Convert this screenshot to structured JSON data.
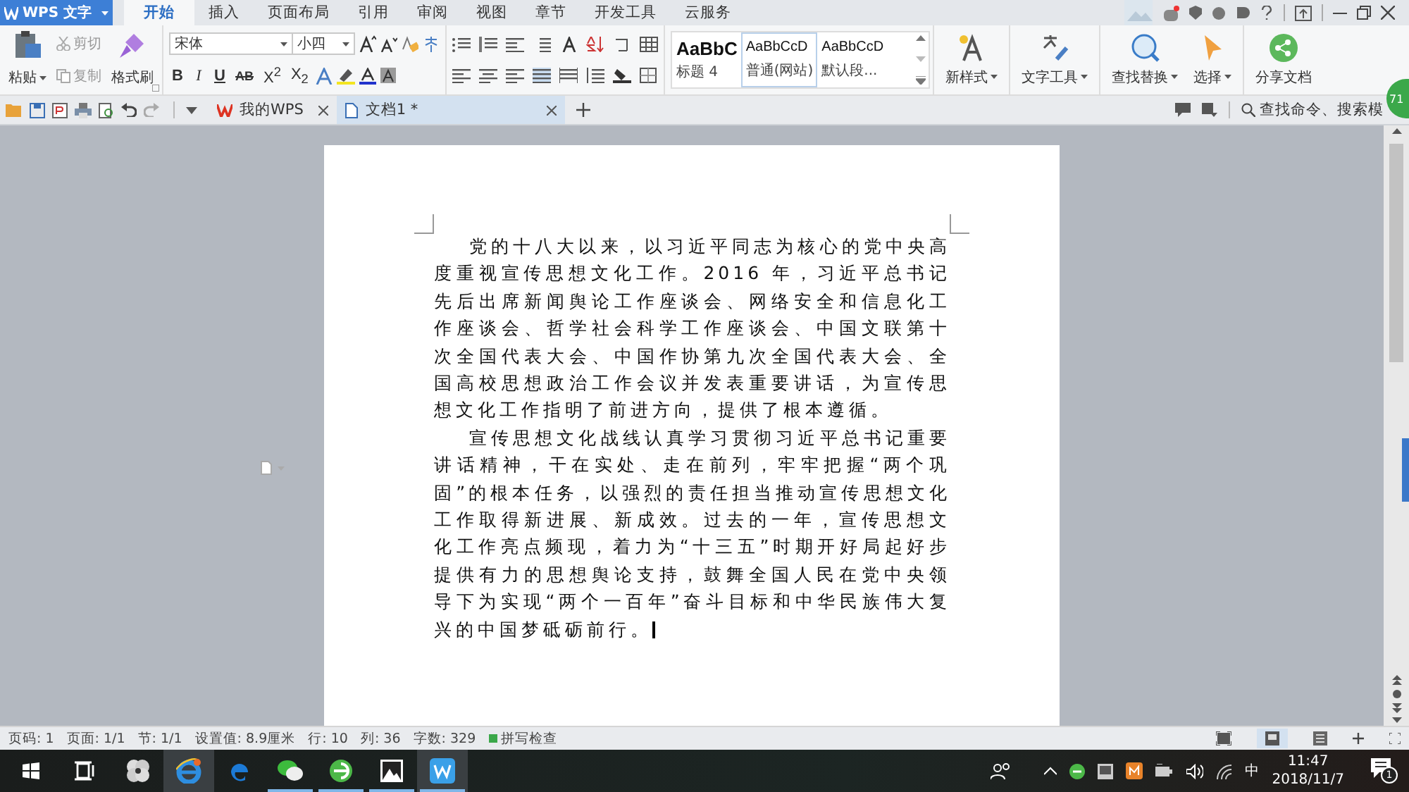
{
  "app_menu": {
    "label": "WPS 文字"
  },
  "ribbon_tabs": [
    {
      "label": "开始",
      "selected": true
    },
    {
      "label": "插入",
      "selected": false
    },
    {
      "label": "页面布局",
      "selected": false
    },
    {
      "label": "引用",
      "selected": false
    },
    {
      "label": "审阅",
      "selected": false
    },
    {
      "label": "视图",
      "selected": false
    },
    {
      "label": "章节",
      "selected": false
    },
    {
      "label": "开发工具",
      "selected": false
    },
    {
      "label": "云服务",
      "selected": false
    }
  ],
  "clipboard": {
    "paste": "粘贴",
    "cut": "剪切",
    "copy": "复制",
    "format_painter": "格式刷"
  },
  "font": {
    "name": "宋体",
    "size": "小四",
    "buttons": [
      "B",
      "I",
      "U",
      "AB",
      "X$^{2}$",
      "X$_{2}$"
    ]
  },
  "styles": [
    {
      "preview": "AaBbC",
      "name": "标题 4",
      "selected": false
    },
    {
      "preview": "AaBbCcD",
      "name": "普通(网站)",
      "selected": true
    },
    {
      "preview": "AaBbCcD",
      "name": "默认段...",
      "selected": false
    }
  ],
  "tools": [
    {
      "kind": "style",
      "label": "新样式",
      "menu": true
    },
    {
      "kind": "tools",
      "label": "文字工具",
      "menu": true
    },
    {
      "kind": "find",
      "label": "查找替换",
      "menu": true
    },
    {
      "kind": "select",
      "label": "选择",
      "menu": true
    },
    {
      "kind": "share",
      "label": "分享文档",
      "menu": false
    }
  ],
  "doc_tabs": [
    {
      "label": "我的WPS",
      "selected": false
    },
    {
      "label": "文档1 *",
      "selected": true
    }
  ],
  "command_search": {
    "placeholder": "查找命令、搜索模"
  },
  "badge": "71",
  "document": {
    "paragraphs": [
      "党的十八大以来，以习近平同志为核心的党中央高度重视宣传思想文化工作。2016 年，习近平总书记先后出席新闻舆论工作座谈会、网络安全和信息化工作座谈会、哲学社会科学工作座谈会、中国文联第十次全国代表大会、中国作协第九次全国代表大会、全国高校思想政治工作会议并发表重要讲话，为宣传思想文化工作指明了前进方向，提供了根本遵循。",
      "宣传思想文化战线认真学习贯彻习近平总书记重要讲话精神，干在实处、走在前列，牢牢把握“两个巩固”的根本任务，以强烈的责任担当推动宣传思想文化工作取得新进展、新成效。过去的一年，宣传思想文化工作亮点频现，着力为“十三五”时期开好局起好步提供有力的思想舆论支持，鼓舞全国人民在党中央领导下为实现“两个一百年”奋斗目标和中华民族伟大复兴的中国梦砥砺前行。"
    ]
  },
  "status_bar": [
    "页码: 1",
    "页面: 1/1",
    "节: 1/1",
    "设置值: 8.9厘米",
    "行: 10",
    "列: 36",
    "字数: 329",
    "拼写检查"
  ],
  "taskbar": {
    "apps": [
      {
        "kind": "taskview",
        "running": false,
        "selected": false
      },
      {
        "kind": "fan",
        "running": false,
        "selected": false
      },
      {
        "kind": "ie",
        "running": false,
        "selected": true
      },
      {
        "kind": "edge",
        "running": false,
        "selected": false
      },
      {
        "kind": "wechat",
        "running": true,
        "selected": false
      },
      {
        "kind": "browser360",
        "running": true,
        "selected": false
      },
      {
        "kind": "photos",
        "running": true,
        "selected": false
      },
      {
        "kind": "wps",
        "running": true,
        "selected": true
      }
    ],
    "ime": "中",
    "time": "11:47",
    "date": "2018/11/7",
    "notifications": "1"
  }
}
